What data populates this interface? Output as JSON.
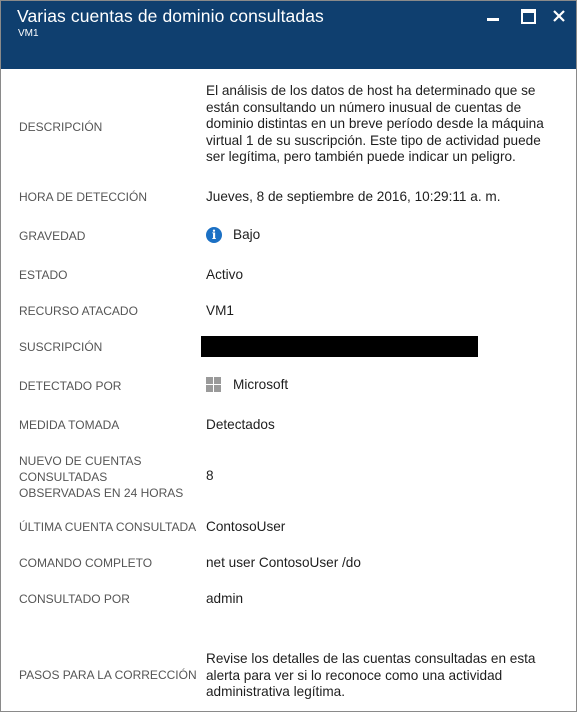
{
  "window": {
    "title": "Varias cuentas de dominio consultadas",
    "subtitle": "VM1"
  },
  "details": {
    "descripcion_label": "DESCRIPCIÓN",
    "descripcion_value": "El análisis de los datos de host ha determinado que se están consultando un número inusual de cuentas de dominio distintas en un breve período desde la máquina virtual 1 de su suscripción. Este tipo de actividad puede ser legítima, pero también puede indicar un peligro.",
    "hora_label": "HORA DE DETECCIÓN",
    "hora_value": "Jueves, 8 de septiembre de 2016, 10:29:11 a. m.",
    "gravedad_label": "GRAVEDAD",
    "gravedad_value": "Bajo",
    "estado_label": "ESTADO",
    "estado_value": "Activo",
    "recurso_label": "RECURSO ATACADO",
    "recurso_value": "VM1",
    "suscripcion_label": "SUSCRIPCIÓN",
    "detectado_label": "DETECTADO POR",
    "detectado_value": "Microsoft",
    "medida_label": "MEDIDA TOMADA",
    "medida_value": "Detectados",
    "nuevo_label": "NUEVO DE CUENTAS CONSULTADAS OBSERVADAS EN 24 HORAS",
    "nuevo_value": "8",
    "ultima_label": "ÚLTIMA CUENTA CONSULTADA",
    "ultima_value": "ContosoUser",
    "comando_label": "COMANDO COMPLETO",
    "comando_value": "net user ContosoUser /do",
    "consultado_label": "CONSULTADO POR",
    "consultado_value": "admin",
    "pasos_label": "PASOS PARA LA CORRECCIÓN",
    "pasos_value": "Revise los detalles de las cuentas consultadas en esta alerta para ver si lo reconoce como una actividad administrativa legítima."
  },
  "icons": {
    "severity": "info-icon",
    "detector": "windows-logo-icon"
  },
  "colors": {
    "header_bg": "#0f3f6f",
    "info_blue": "#1b70c4"
  }
}
